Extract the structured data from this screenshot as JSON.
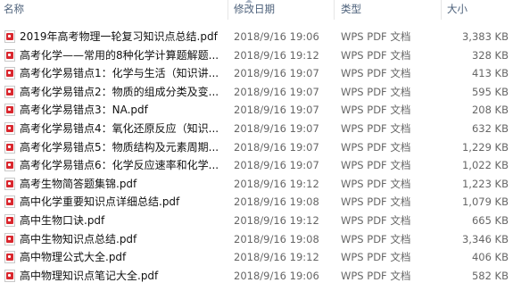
{
  "columns": {
    "name": "名称",
    "date": "修改日期",
    "type": "类型",
    "size": "大小"
  },
  "icon": "pdf-file-icon",
  "accent_color": "#d9272e",
  "files": [
    {
      "name": "2019年高考物理一轮复习知识点总结.pdf",
      "date": "2018/9/16 19:06",
      "type": "WPS PDF 文档",
      "size": "3,383 KB"
    },
    {
      "name": "高考化学——常用的8种化学计算题解题...",
      "date": "2018/9/16 19:12",
      "type": "WPS PDF 文档",
      "size": "328 KB"
    },
    {
      "name": "高考化学易错点1：化学与生活（知识讲...",
      "date": "2018/9/16 19:07",
      "type": "WPS PDF 文档",
      "size": "413 KB"
    },
    {
      "name": "高考化学易错点2：物质的组成分类及变...",
      "date": "2018/9/16 19:07",
      "type": "WPS PDF 文档",
      "size": "595 KB"
    },
    {
      "name": "高考化学易错点3：NA.pdf",
      "date": "2018/9/16 19:07",
      "type": "WPS PDF 文档",
      "size": "208 KB"
    },
    {
      "name": "高考化学易错点4：氧化还原反应（知识...",
      "date": "2018/9/16 19:07",
      "type": "WPS PDF 文档",
      "size": "632 KB"
    },
    {
      "name": "高考化学易错点5：物质结构及元素周期...",
      "date": "2018/9/16 19:07",
      "type": "WPS PDF 文档",
      "size": "1,229 KB"
    },
    {
      "name": "高考化学易错点6：化学反应速率和化学...",
      "date": "2018/9/16 19:07",
      "type": "WPS PDF 文档",
      "size": "1,022 KB"
    },
    {
      "name": "高考生物简答题集锦.pdf",
      "date": "2018/9/16 19:12",
      "type": "WPS PDF 文档",
      "size": "1,223 KB"
    },
    {
      "name": "高中化学重要知识点详细总结.pdf",
      "date": "2018/9/16 19:08",
      "type": "WPS PDF 文档",
      "size": "1,079 KB"
    },
    {
      "name": "高中生物口诀.pdf",
      "date": "2018/9/16 19:12",
      "type": "WPS PDF 文档",
      "size": "665 KB"
    },
    {
      "name": "高中生物知识点总结.pdf",
      "date": "2018/9/16 19:08",
      "type": "WPS PDF 文档",
      "size": "3,346 KB"
    },
    {
      "name": "高中物理公式大全.pdf",
      "date": "2018/9/16 19:12",
      "type": "WPS PDF 文档",
      "size": "406 KB"
    },
    {
      "name": "高中物理知识点笔记大全.pdf",
      "date": "2018/9/16 19:06",
      "type": "WPS PDF 文档",
      "size": "582 KB"
    }
  ]
}
